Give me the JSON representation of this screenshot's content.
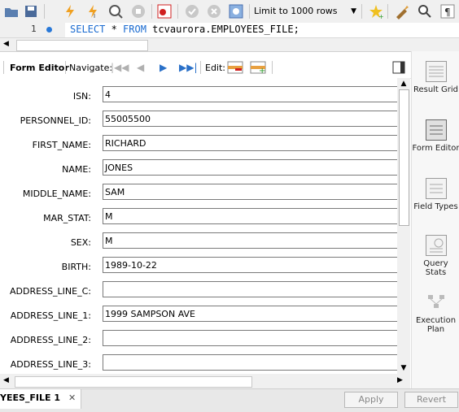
{
  "toolbar": {
    "limit_label": "Limit to 1000 rows",
    "icons": [
      "open-folder-icon",
      "save-icon",
      "execute-icon",
      "execute-current-icon",
      "explain-icon",
      "stop-icon",
      "toggle-continue-icon",
      "commit-icon",
      "rollback-icon",
      "autocommit-icon",
      "limit-dropdown",
      "bookmark-icon",
      "beautify-icon",
      "find-icon",
      "invisible-chars-icon"
    ]
  },
  "editor": {
    "line_number": "1",
    "sql_kw1": "SELECT",
    "sql_star": " * ",
    "sql_kw2": "FROM",
    "sql_rest": " tcvaurora.EMPLOYEES_FILE;"
  },
  "form_toolbar": {
    "form_editor_label": "Form Editor",
    "navigate_label": "Navigate:",
    "edit_label": "Edit:"
  },
  "fields": [
    {
      "label": "ISN:",
      "value": "4"
    },
    {
      "label": "PERSONNEL_ID:",
      "value": "55005500"
    },
    {
      "label": "FIRST_NAME:",
      "value": "RICHARD"
    },
    {
      "label": "NAME:",
      "value": "JONES"
    },
    {
      "label": "MIDDLE_NAME:",
      "value": "SAM"
    },
    {
      "label": "MAR_STAT:",
      "value": "M"
    },
    {
      "label": "SEX:",
      "value": "M"
    },
    {
      "label": "BIRTH:",
      "value": "1989-10-22"
    },
    {
      "label": "ADDRESS_LINE_C:",
      "value": ""
    },
    {
      "label": "ADDRESS_LINE_1:",
      "value": "1999 SAMPSON AVE"
    },
    {
      "label": "ADDRESS_LINE_2:",
      "value": ""
    },
    {
      "label": "ADDRESS_LINE_3:",
      "value": ""
    }
  ],
  "right_panel": {
    "result_grid": "Result Grid",
    "form_editor": "Form Editor",
    "field_types": "Field Types",
    "query_stats": "Query Stats",
    "execution_plan": "Execution Plan"
  },
  "bottom": {
    "tab_label": "YEES_FILE 1",
    "tab_close": "✕",
    "apply_label": "Apply",
    "revert_label": "Revert"
  },
  "colors": {
    "keyword": "#1a6bd0",
    "line_dot": "#2878d8"
  }
}
